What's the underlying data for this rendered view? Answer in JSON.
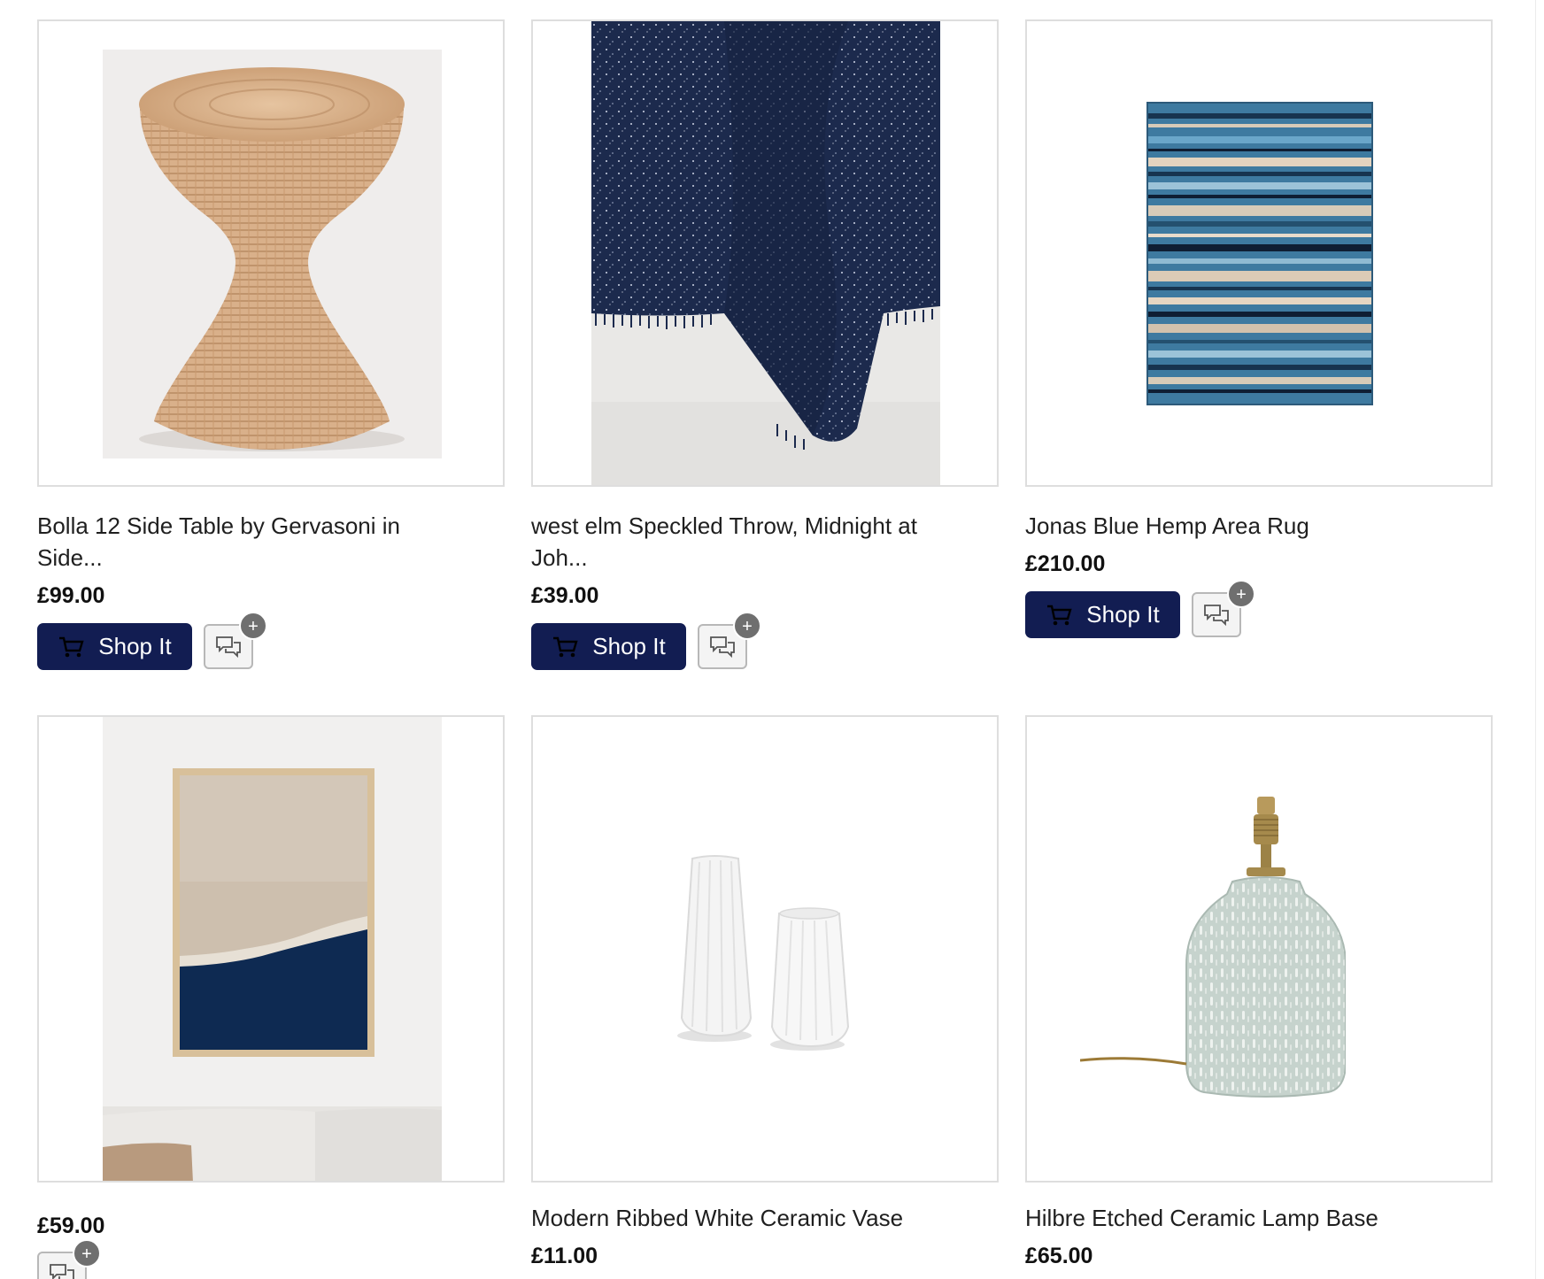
{
  "products": [
    {
      "title": "Bolla 12 Side Table by Gervasoni in Side...",
      "price": "£99.00",
      "shop_label": "Shop It",
      "badge": "+",
      "image": "wicker-side-table"
    },
    {
      "title": "west elm Speckled Throw, Midnight at Joh...",
      "price": "£39.00",
      "shop_label": "Shop It",
      "badge": "+",
      "image": "navy-speckled-throw"
    },
    {
      "title": "Jonas Blue Hemp Area Rug",
      "price": "£210.00",
      "shop_label": "Shop It",
      "badge": "+",
      "image": "blue-striped-rug"
    },
    {
      "title": "",
      "price": "£59.00",
      "badge": "+",
      "image": "framed-beach-art-print"
    },
    {
      "title": "Modern Ribbed White Ceramic Vase",
      "price": "£11.00",
      "image": "white-ribbed-vases"
    },
    {
      "title": "Hilbre Etched Ceramic Lamp Base",
      "price": "£65.00",
      "image": "etched-ceramic-lamp-base"
    }
  ],
  "colors": {
    "shop_button": "#121d52",
    "card_border": "#dedede",
    "badge": "#6f6f6f"
  },
  "icons": [
    "cart-icon",
    "comment-icon",
    "plus-icon"
  ]
}
